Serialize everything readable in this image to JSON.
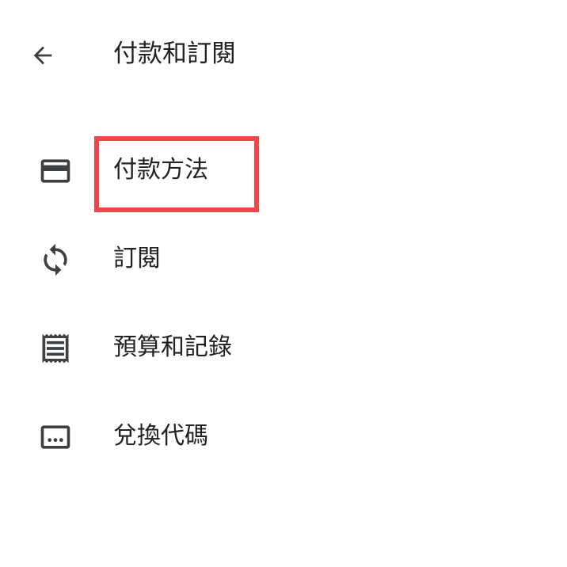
{
  "header": {
    "title": "付款和訂閱",
    "back_icon": "arrow-back-icon"
  },
  "menu": {
    "items": [
      {
        "label": "付款方法",
        "icon": "credit-card-icon"
      },
      {
        "label": "訂閱",
        "icon": "sync-icon"
      },
      {
        "label": "預算和記錄",
        "icon": "receipt-icon"
      },
      {
        "label": "兌換代碼",
        "icon": "redeem-code-icon"
      }
    ]
  },
  "colors": {
    "text": "#202124",
    "icon": "#5f6368",
    "highlight": "#f2444b",
    "background": "#ffffff"
  }
}
